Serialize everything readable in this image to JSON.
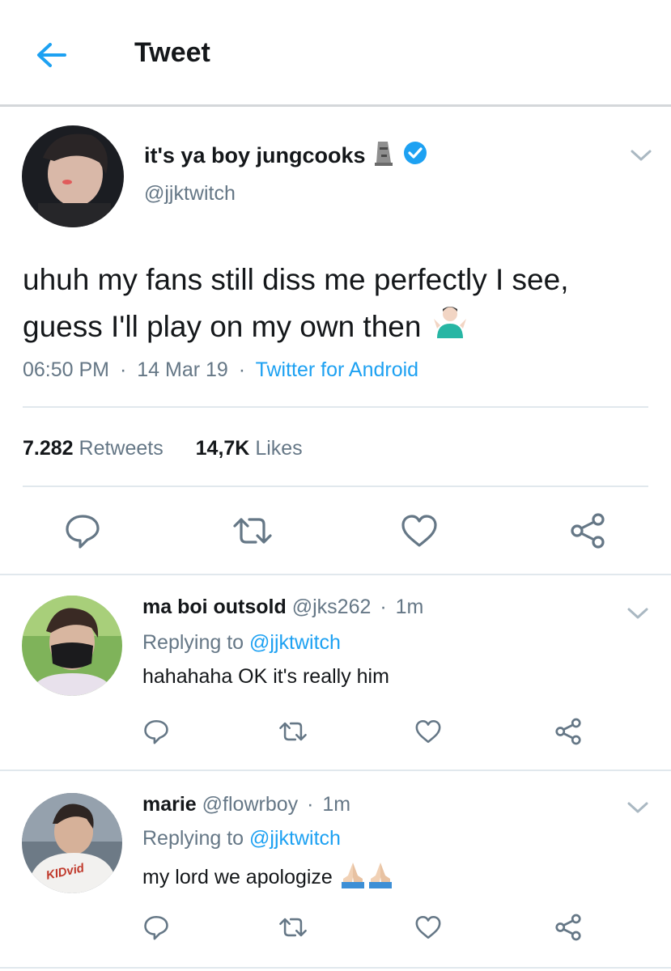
{
  "header": {
    "title": "Tweet",
    "back_icon": "arrow-left-icon"
  },
  "colors": {
    "accent": "#1da1f2",
    "muted": "#657786",
    "text": "#14171a",
    "divider": "#e1e8ed",
    "verified": "#1da1f2"
  },
  "tweet": {
    "name": "it's ya boy jungcooks",
    "name_emoji": "moai-emoji",
    "verified_icon": "verified-badge-icon",
    "handle": "@jjktwitch",
    "text_line1": "uhuh my fans still diss me perfectly I see,",
    "text_line2": "guess I'll play on my own then",
    "text_emoji": "man-shrugging-emoji",
    "time": "06:50 PM",
    "date": "14 Mar 19",
    "client": "Twitter for Android",
    "sep": "·",
    "retweets_count": "7.282",
    "retweets_label": "Retweets",
    "likes_count": "14,7K",
    "likes_label": "Likes"
  },
  "replies": [
    {
      "name": "ma boi outsold",
      "handle": "@jks262",
      "time": "1m",
      "replying_prefix": "Replying to",
      "replying_to": "@jjktwitch",
      "text": "hahahaha OK it's really him"
    },
    {
      "name": "marie",
      "handle": "@flowrboy",
      "time": "1m",
      "replying_prefix": "Replying to",
      "replying_to": "@jjktwitch",
      "text": "my lord we apologize",
      "emoji": "folded-hands-emoji"
    }
  ],
  "avatar_text": {
    "kidvid": "KIDvid"
  }
}
